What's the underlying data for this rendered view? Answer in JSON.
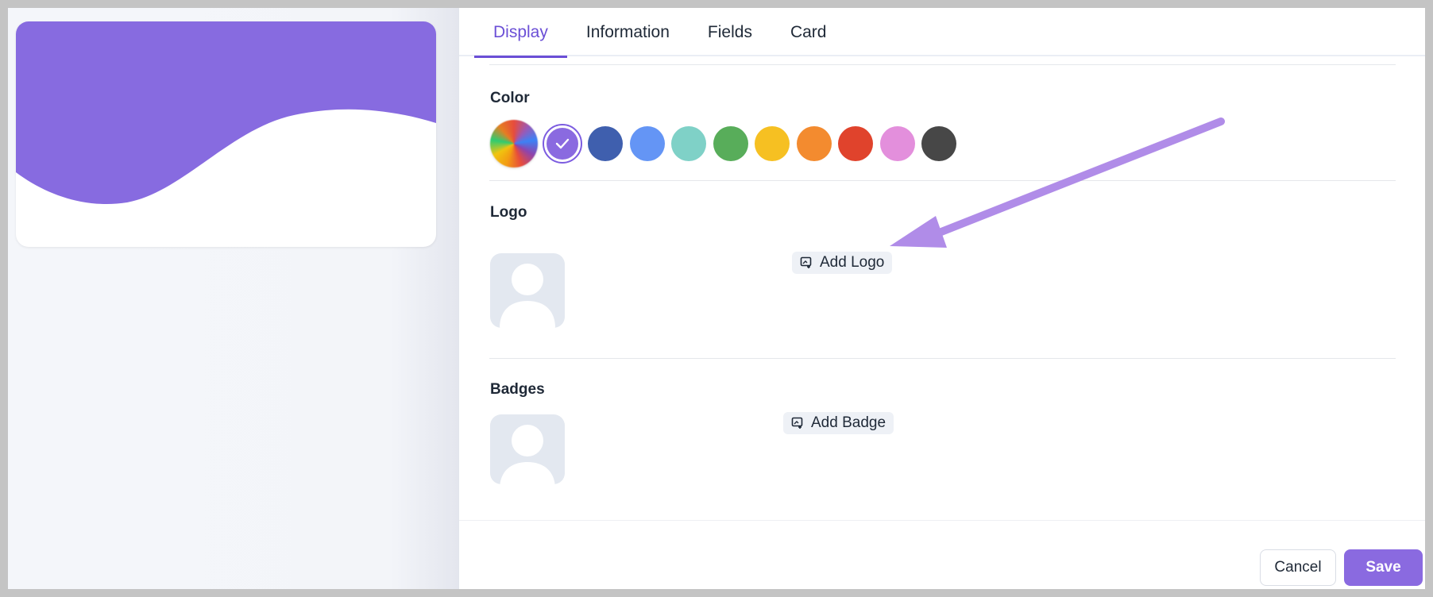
{
  "tabs": [
    {
      "label": "Display",
      "active": true
    },
    {
      "label": "Information",
      "active": false
    },
    {
      "label": "Fields",
      "active": false
    },
    {
      "label": "Card",
      "active": false
    }
  ],
  "color_section": {
    "label": "Color",
    "selected": "#8a6ae0",
    "swatches": [
      "multicolor",
      "#8a6ae0",
      "#3f5fae",
      "#6495f5",
      "#7fd1c7",
      "#58ad5a",
      "#f6c022",
      "#f38b2f",
      "#e0432c",
      "#e38fdc",
      "#474747"
    ]
  },
  "logo_section": {
    "label": "Logo",
    "add_label": "Add Logo"
  },
  "badges_section": {
    "label": "Badges",
    "add_label": "Add Badge"
  },
  "footer": {
    "cancel_label": "Cancel",
    "save_label": "Save"
  },
  "colors": {
    "accent": "#8a6ae0",
    "annotation_arrow": "#b08ce8"
  }
}
